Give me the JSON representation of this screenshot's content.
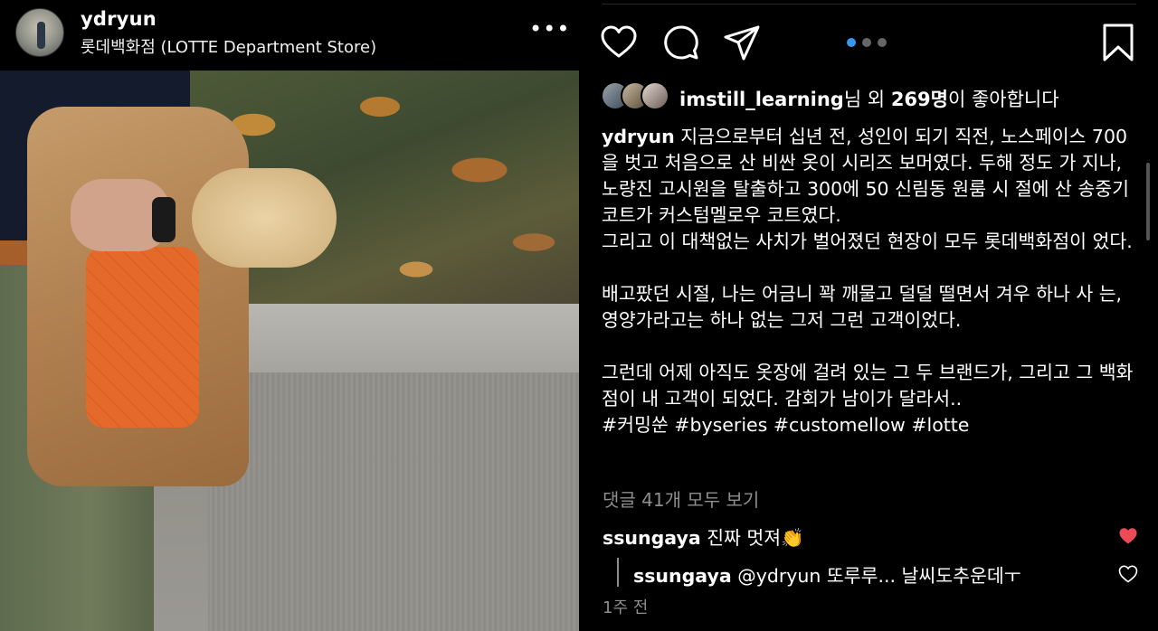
{
  "post": {
    "username": "ydryun",
    "location": "롯데백화점 (LOTTE Department Store)",
    "more_label": "•••"
  },
  "actions": {
    "like_icon": "heart-outline-icon",
    "comment_icon": "comment-bubble-icon",
    "share_icon": "paper-plane-icon",
    "save_icon": "bookmark-icon",
    "carousel": {
      "total": 3,
      "active": 1
    }
  },
  "likes": {
    "liker": "imstill_learning",
    "mid_text": "님 외 ",
    "count": "269명",
    "suffix": "이 좋아합니다"
  },
  "caption": {
    "author": "ydryun",
    "para1": " 지금으로부터 십년 전, 성인이 되기 직전, 노스페이스 700을 벗고 처음으로 산 비싼 옷이 시리즈 보머였다. 두해 정도 가 지나, 노량진 고시원을 탈출하고 300에 50 신림동 원룸 시 절에 산 송중기 코트가 커스텀멜로우 코트였다.",
    "para2": "그리고 이 대책없는 사치가 벌어졌던 현장이 모두 롯데백화점이 었다.",
    "para3": "배고팠던 시절, 나는 어금니 꽉 깨물고 덜덜 떨면서 겨우 하나 사 는, 영양가라고는 하나 없는 그저 그런 고객이었다.",
    "para4": "그런데 어제 아직도 옷장에 걸려 있는 그 두 브랜드가, 그리고 그 백화점이 내 고객이 되었다. 감회가 남이가 달라서..",
    "hashtags": "#커밍쑨 #byseries #customellow #lotte"
  },
  "comments": {
    "view_all": "댓글 41개 모두 보기",
    "items": [
      {
        "user": "ssungaya",
        "text": " 진짜 멋져👏",
        "liked": true
      },
      {
        "user": "ssungaya",
        "text": " @ydryun 또루루... 날씨도추운데ㅜ",
        "liked": false,
        "is_reply": true
      }
    ],
    "timestamp": "1주 전"
  },
  "colors": {
    "background": "#000000",
    "muted_text": "#8e8e8e",
    "like_red": "#ed4956",
    "active_dot": "#3897f0"
  }
}
